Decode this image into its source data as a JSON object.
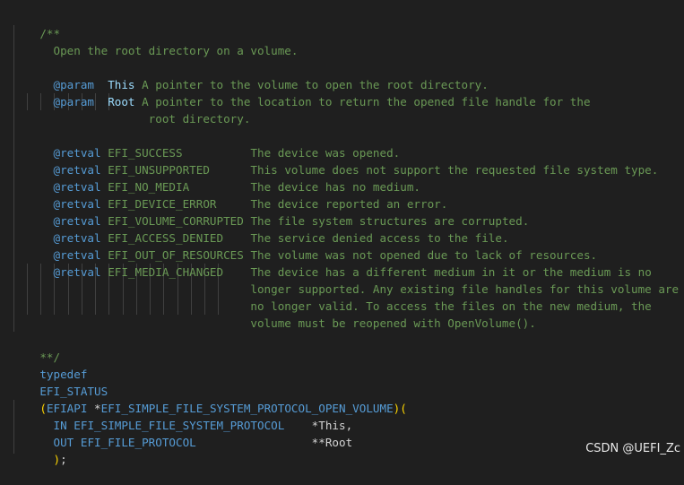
{
  "comment": {
    "open": "/**",
    "summary": "Open the root directory on a volume.",
    "params": [
      {
        "tag": "@param",
        "name": "This",
        "desc": "A pointer to the volume to open the root directory."
      },
      {
        "tag": "@param",
        "name": "Root",
        "desc": "A pointer to the location to return the opened file handle for the",
        "cont": "root directory."
      }
    ],
    "retvals": [
      {
        "tag": "@retval",
        "code": "EFI_SUCCESS",
        "desc": "The device was opened."
      },
      {
        "tag": "@retval",
        "code": "EFI_UNSUPPORTED",
        "desc": "This volume does not support the requested file system type."
      },
      {
        "tag": "@retval",
        "code": "EFI_NO_MEDIA",
        "desc": "The device has no medium."
      },
      {
        "tag": "@retval",
        "code": "EFI_DEVICE_ERROR",
        "desc": "The device reported an error."
      },
      {
        "tag": "@retval",
        "code": "EFI_VOLUME_CORRUPTED",
        "desc": "The file system structures are corrupted."
      },
      {
        "tag": "@retval",
        "code": "EFI_ACCESS_DENIED",
        "desc": "The service denied access to the file."
      },
      {
        "tag": "@retval",
        "code": "EFI_OUT_OF_RESOURCES",
        "desc": "The volume was not opened due to lack of resources."
      },
      {
        "tag": "@retval",
        "code": "EFI_MEDIA_CHANGED",
        "desc": "The device has a different medium in it or the medium is no"
      }
    ],
    "media_changed_cont": [
      "longer supported. Any existing file handles for this volume are",
      "no longer valid. To access the files on the new medium, the",
      "volume must be reopened with OpenVolume()."
    ],
    "close": "**/"
  },
  "code": {
    "typedef": "typedef",
    "return_type": "EFI_STATUS",
    "open_paren": "(",
    "efiapi": "EFIAPI",
    "star": "*",
    "func_name": "EFI_SIMPLE_FILE_SYSTEM_PROTOCOL_OPEN_VOLUME",
    "close_paren": ")",
    "open_paren2": "(",
    "arg1_dir": "IN",
    "arg1_type": "EFI_SIMPLE_FILE_SYSTEM_PROTOCOL",
    "arg1_name": "*This,",
    "arg2_dir": "OUT",
    "arg2_type": "EFI_FILE_PROTOCOL",
    "arg2_name": "**Root",
    "close_paren2": ")",
    "semicolon": ";"
  },
  "watermark": "CSDN @UEFI_Zc"
}
